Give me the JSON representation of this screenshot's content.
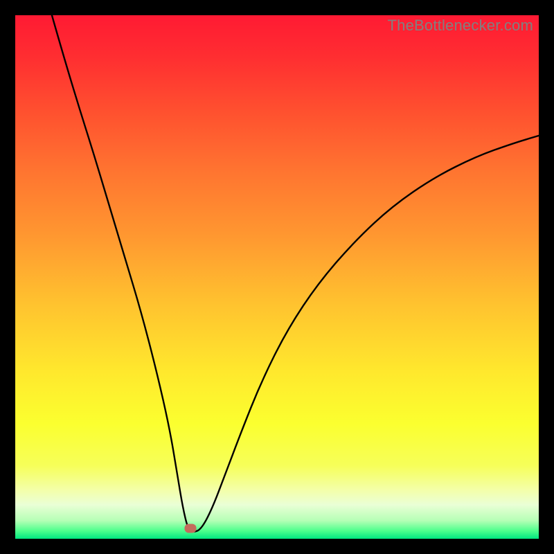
{
  "watermark": "TheBottlenecker.com",
  "marker": {
    "x": 0.335,
    "y_from_bottom": 0.02
  },
  "gradient": {
    "stops": [
      {
        "offset": 0.0,
        "color": "#ff1a33"
      },
      {
        "offset": 0.08,
        "color": "#ff2e31"
      },
      {
        "offset": 0.18,
        "color": "#ff4f2f"
      },
      {
        "offset": 0.3,
        "color": "#ff7530"
      },
      {
        "offset": 0.42,
        "color": "#ff9730"
      },
      {
        "offset": 0.55,
        "color": "#ffc22f"
      },
      {
        "offset": 0.68,
        "color": "#ffe82d"
      },
      {
        "offset": 0.78,
        "color": "#fbff2f"
      },
      {
        "offset": 0.86,
        "color": "#f6ff59"
      },
      {
        "offset": 0.905,
        "color": "#f4ffa6"
      },
      {
        "offset": 0.935,
        "color": "#eaffd6"
      },
      {
        "offset": 0.965,
        "color": "#b6ffb6"
      },
      {
        "offset": 0.985,
        "color": "#4dff8c"
      },
      {
        "offset": 1.0,
        "color": "#00e680"
      }
    ]
  },
  "chart_data": {
    "type": "line",
    "title": "",
    "xlabel": "",
    "ylabel": "",
    "xlim": [
      0,
      1
    ],
    "ylim": [
      0,
      1
    ],
    "series": [
      {
        "name": "bottleneck-curve",
        "x": [
          0.07,
          0.09,
          0.12,
          0.15,
          0.18,
          0.21,
          0.24,
          0.27,
          0.295,
          0.31,
          0.32,
          0.33,
          0.34,
          0.355,
          0.375,
          0.4,
          0.43,
          0.47,
          0.52,
          0.58,
          0.65,
          0.72,
          0.8,
          0.88,
          0.95,
          1.0
        ],
        "y": [
          1.0,
          0.93,
          0.83,
          0.735,
          0.635,
          0.535,
          0.435,
          0.32,
          0.21,
          0.12,
          0.06,
          0.018,
          0.012,
          0.018,
          0.055,
          0.12,
          0.2,
          0.3,
          0.4,
          0.49,
          0.57,
          0.635,
          0.69,
          0.73,
          0.755,
          0.77
        ]
      }
    ],
    "annotations": [
      {
        "name": "optimal-point",
        "x": 0.335,
        "y": 0.02
      }
    ]
  }
}
